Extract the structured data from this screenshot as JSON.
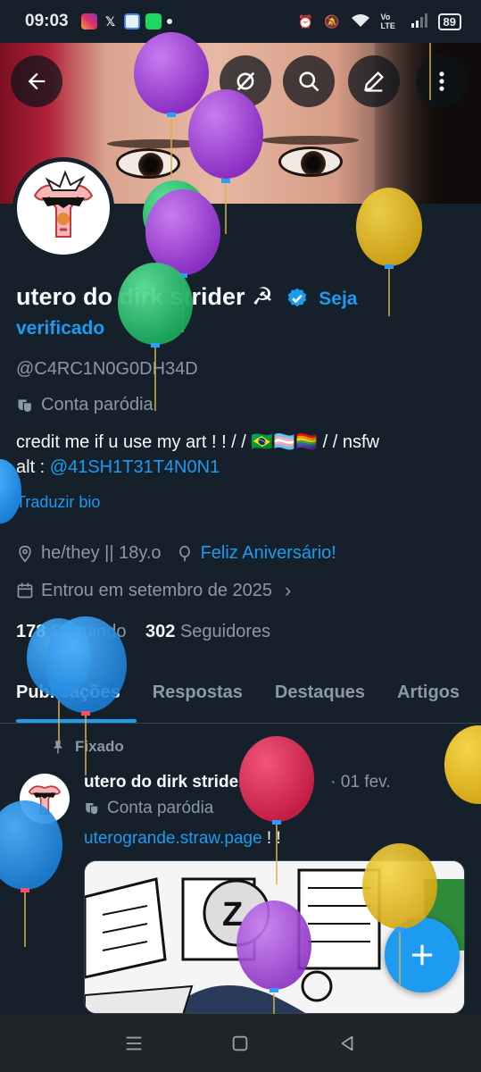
{
  "status_bar": {
    "time": "09:03",
    "network_label": "Vo LTE",
    "battery": "89"
  },
  "profile": {
    "display_name": "utero do dirk strider ☭",
    "verify_prompt_1": "Seja",
    "verify_prompt_2": "verificado",
    "handle": "@C4RC1N0G0DH34D",
    "parody_label": "Conta paródia",
    "bio_line1": "credit me if u use my art ! ! / / 🇧🇷🏳️‍⚧️🏳️‍🌈 / / nsfw",
    "bio_line2_prefix": "alt : ",
    "bio_line2_link": "@41SH1T31T4N0N1",
    "translate_bio": "Traduzir bio",
    "location": "he/they || 18y.o",
    "birthday": "Feliz Aniversário!",
    "joined": "Entrou em setembro de 2025",
    "following_count": "178",
    "following_label": "Seguindo",
    "followers_count": "302",
    "followers_label": "Seguidores"
  },
  "tabs": [
    {
      "label": "Publicações",
      "active": true
    },
    {
      "label": "Respostas",
      "active": false
    },
    {
      "label": "Destaques",
      "active": false
    },
    {
      "label": "Artigos",
      "active": false
    }
  ],
  "post": {
    "pinned_label": "Fixado",
    "author_name": "utero do dirk strider ☭",
    "author_handle": "@C...",
    "date": "· 01 fev.",
    "parody_label": "Conta paródia",
    "link_text": "uterogrande.straw.page",
    "text_suffix": " ! !",
    "media_letter": "Z"
  },
  "icons": {
    "back": "back-arrow-icon",
    "grok": "grok-icon",
    "search": "search-icon",
    "edit": "edit-icon",
    "more": "more-vertical-icon",
    "parody": "theater-masks-icon",
    "location": "location-pin-icon",
    "birthday": "balloon-icon",
    "calendar": "calendar-icon",
    "pin": "pin-icon",
    "compose": "plus-icon"
  },
  "colors": {
    "accent": "#1d9bf0",
    "background": "#15202b",
    "secondary_text": "#8b98a5"
  }
}
